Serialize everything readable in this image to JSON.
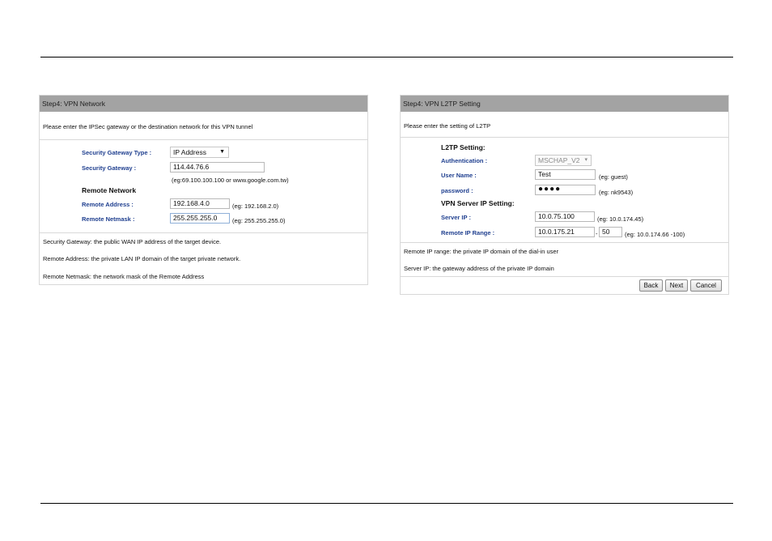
{
  "vpn_network": {
    "header": "Step4: VPN Network",
    "intro": "Please enter the IPSec gateway or the destination network for this VPN tunnel",
    "security_gateway_type": {
      "label": "Security Gateway Type :",
      "value": "IP Address"
    },
    "security_gateway": {
      "label": "Security Gateway :",
      "value": "114.44.76.6",
      "example": "(eg:69.100.100.100 or www.google.com.tw)"
    },
    "remote_network_title": "Remote Network",
    "remote_address": {
      "label": "Remote Address :",
      "value": "192.168.4.0",
      "example": "(eg: 192.168.2.0)"
    },
    "remote_netmask": {
      "label": "Remote Netmask :",
      "value": "255.255.255.0",
      "example": "(eg: 255.255.255.0)"
    },
    "notes": [
      "Security Gateway: the public WAN IP address of the target device.",
      "Remote Address: the private LAN IP domain of the target private network.",
      "Remote Netmask: the network mask of the Remote Address"
    ]
  },
  "vpn_l2tp": {
    "header": "Step4: VPN L2TP Setting",
    "intro": "Please enter the setting of L2TP",
    "l2tp_title": "L2TP Setting:",
    "authentication": {
      "label": "Authentication :",
      "value": "MSCHAP_V2"
    },
    "user_name": {
      "label": "User Name :",
      "value": "Test",
      "example": "(eg: guest)"
    },
    "password": {
      "label": "password :",
      "value": "●●●●",
      "example": "(eg: nk9543)"
    },
    "server_title": "VPN Server IP Setting:",
    "server_ip": {
      "label": "Server IP :",
      "value": "10.0.75.100",
      "example": "(eg: 10.0.174.45)"
    },
    "remote_ip_range": {
      "label": "Remote IP Range :",
      "start": "10.0.175.21",
      "separator": "-",
      "end": "50",
      "example": "(eg: 10.0.174.66 -100)"
    },
    "notes": [
      "Remote IP range: the private IP domain of the dial-in user",
      "Server IP: the gateway address of the private IP domain"
    ],
    "buttons": {
      "back": "Back",
      "next": "Next",
      "cancel": "Cancel"
    }
  },
  "icons": {
    "dropdown": "chevron-down-icon"
  }
}
